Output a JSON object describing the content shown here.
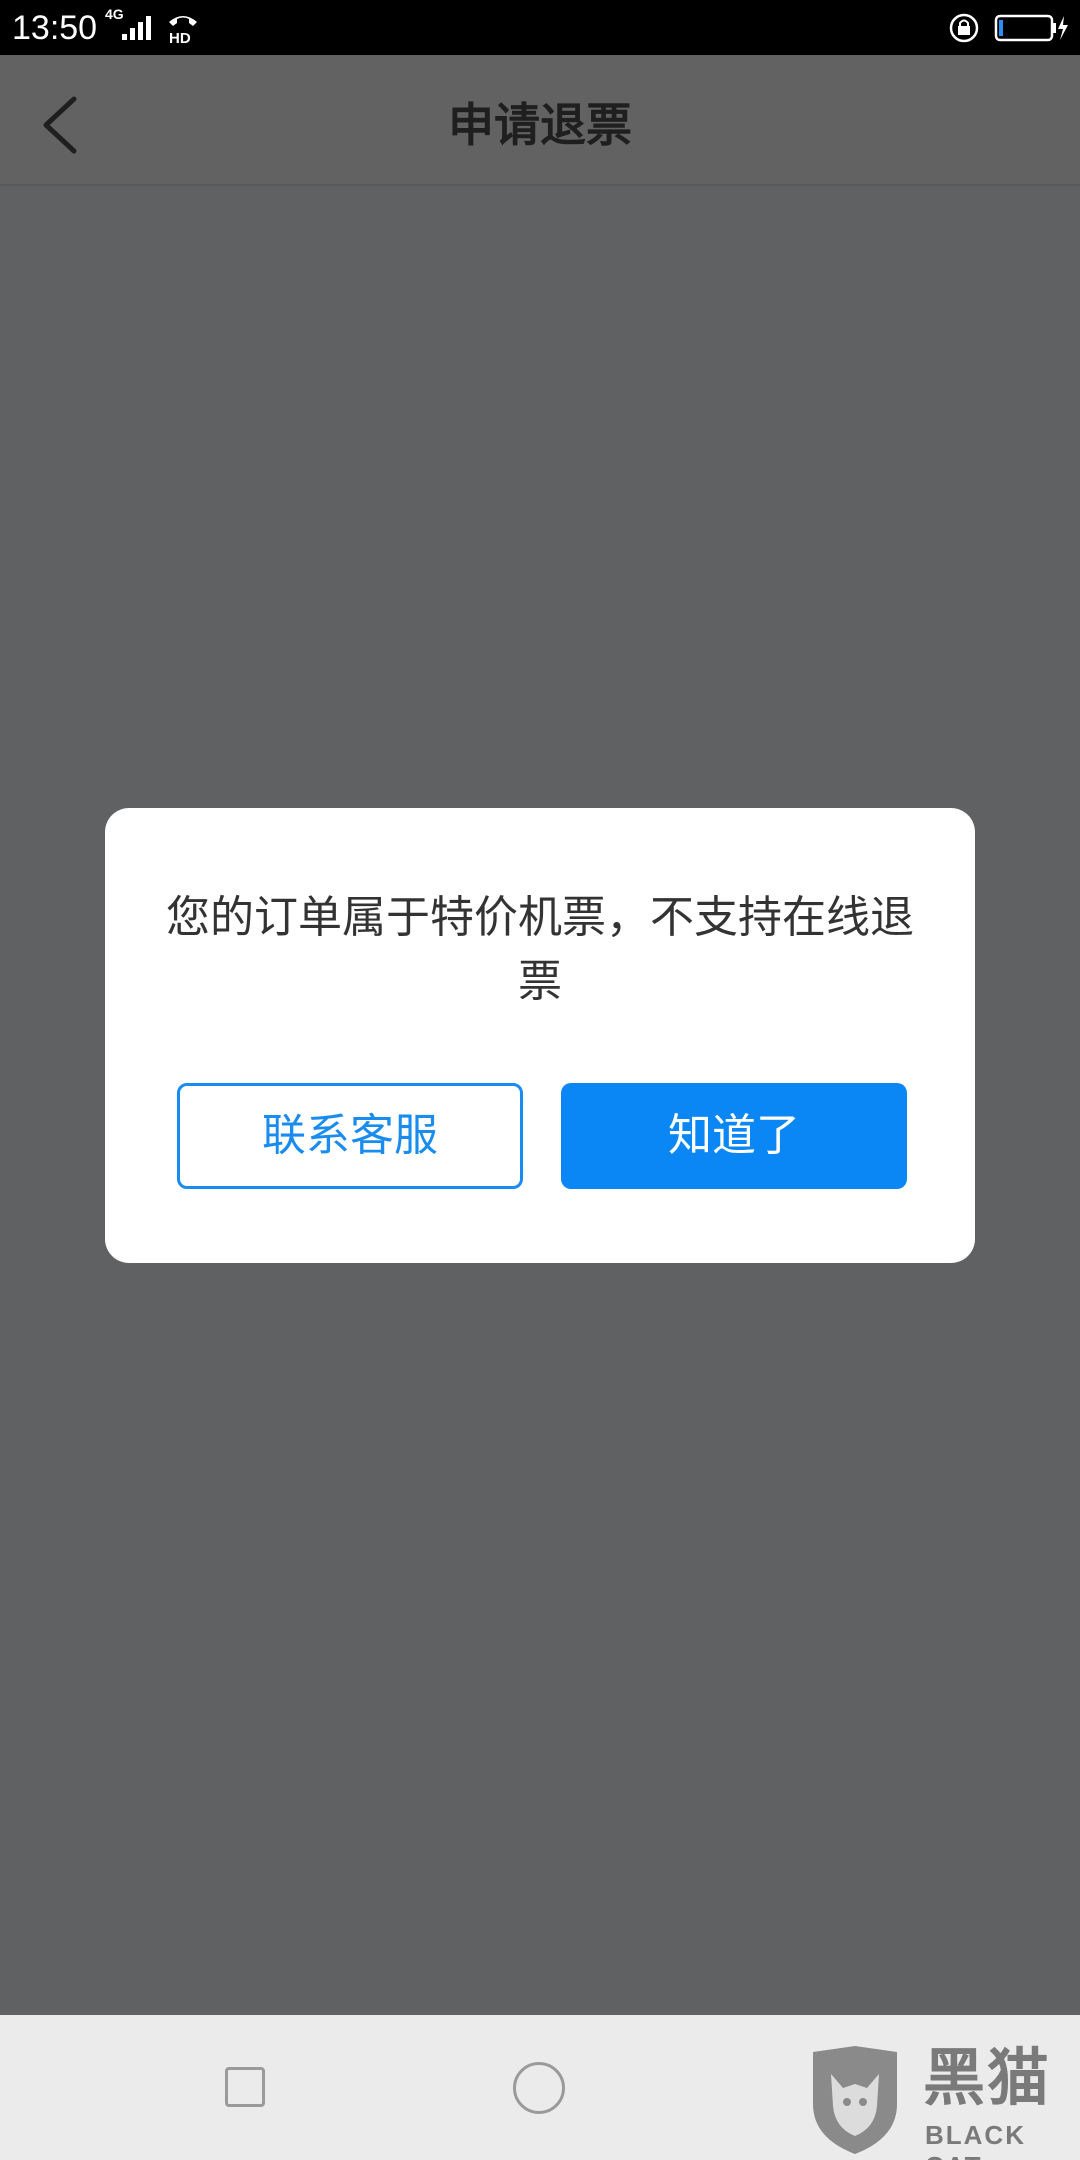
{
  "status_bar": {
    "time": "13:50",
    "network": "4G"
  },
  "header": {
    "title": "申请退票"
  },
  "dialog": {
    "message": "您的订单属于特价机票，不支持在线退票",
    "contact_button": "联系客服",
    "ok_button": "知道了"
  },
  "watermark": {
    "text_cn": "黑猫",
    "text_en": "BLACK CAT"
  },
  "colors": {
    "accent": "#0a87f5",
    "overlay": "#606163",
    "dialog_bg": "#ffffff"
  },
  "icons": {
    "back": "chevron-left-icon",
    "signal": "signal-icon",
    "hd_call": "hd-call-icon",
    "rotation_lock": "rotation-lock-icon",
    "battery": "battery-charging-icon",
    "nav_recent": "square-icon",
    "nav_home": "circle-icon"
  }
}
